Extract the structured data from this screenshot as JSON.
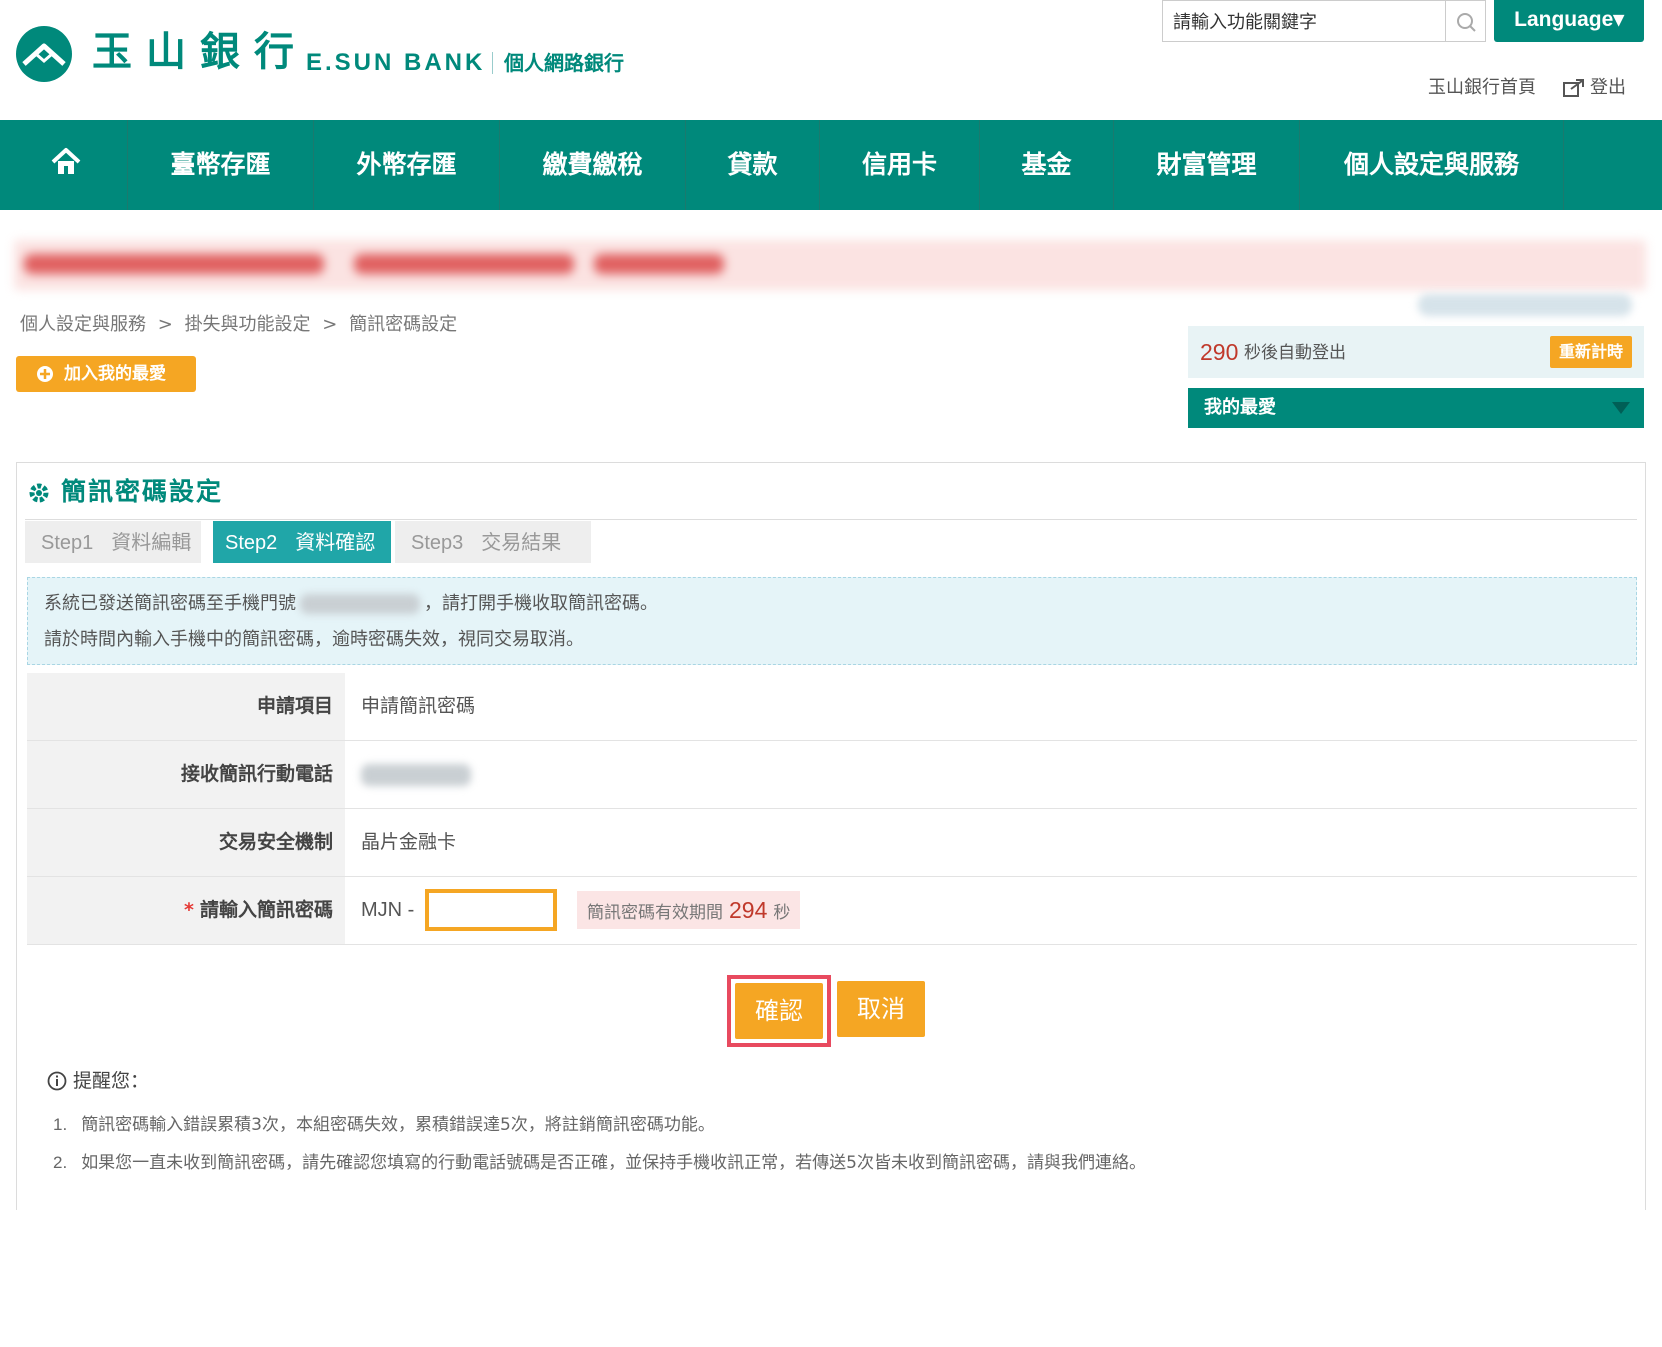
{
  "header": {
    "logo_cn": "玉山銀行",
    "logo_en": "E.SUN BANK",
    "logo_sub": "個人網路銀行",
    "search_placeholder": "請輸入功能關鍵字",
    "language_label": "Language▾",
    "home_link": "玉山銀行首頁",
    "logout_label": "登出"
  },
  "nav": {
    "items": [
      "臺幣存匯",
      "外幣存匯",
      "繳費繳稅",
      "貸款",
      "信用卡",
      "基金",
      "財富管理",
      "個人設定與服務"
    ]
  },
  "breadcrumb": [
    "個人設定與服務",
    "掛失與功能設定",
    "簡訊密碼設定"
  ],
  "breadcrumb_sep": ">",
  "add_favorite_label": "加入我的最愛",
  "session": {
    "seconds": "290",
    "text": "秒後自動登出",
    "reset_label": "重新計時"
  },
  "my_favorites_label": "我的最愛",
  "panel": {
    "title": "簡訊密碼設定",
    "steps": [
      {
        "num": "Step1",
        "label": "資料編輯",
        "active": false
      },
      {
        "num": "Step2",
        "label": "資料確認",
        "active": true
      },
      {
        "num": "Step3",
        "label": "交易結果",
        "active": false
      }
    ],
    "info_line1_a": "系統已發送簡訊密碼至手機門號",
    "info_line1_b": "，請打開手機收取簡訊密碼。",
    "info_line2": "請於時間內輸入手機中的簡訊密碼，逾時密碼失效，視同交易取消。",
    "fields": [
      {
        "label": "申請項目",
        "value": "申請簡訊密碼"
      },
      {
        "label": "接收簡訊行動電話",
        "value": ""
      },
      {
        "label": "交易安全機制",
        "value": "晶片金融卡"
      },
      {
        "label": "請輸入簡訊密碼",
        "value": ""
      }
    ],
    "required_mark": "*",
    "otp_prefix": "MJN -",
    "otp_valid_text": "簡訊密碼有效期間",
    "otp_valid_seconds": "294",
    "otp_valid_unit": "秒",
    "confirm_label": "確認",
    "cancel_label": "取消",
    "reminder_title": "提醒您：",
    "reminders": [
      {
        "num": "1.",
        "text": "簡訊密碼輸入錯誤累積3次，本組密碼失效，累積錯誤達5次，將註銷簡訊密碼功能。"
      },
      {
        "num": "2.",
        "text": "如果您一直未收到簡訊密碼，請先確認您填寫的行動電話號碼是否正確，並保持手機收訊正常，若傳送5次皆未收到簡訊密碼，請與我們連絡。"
      }
    ]
  },
  "colors": {
    "brand": "#00897b",
    "accent": "#f5a623",
    "highlight": "#e84a5f",
    "step_active": "#20a6a8"
  },
  "icons": {
    "logo": "esun-mountain-logo",
    "search": "search-icon",
    "home": "home-icon",
    "add": "plus-circle-icon",
    "gear": "gear-icon",
    "logout": "logout-icon",
    "info": "info-circle-icon",
    "dropdown": "chevron-down-icon"
  }
}
